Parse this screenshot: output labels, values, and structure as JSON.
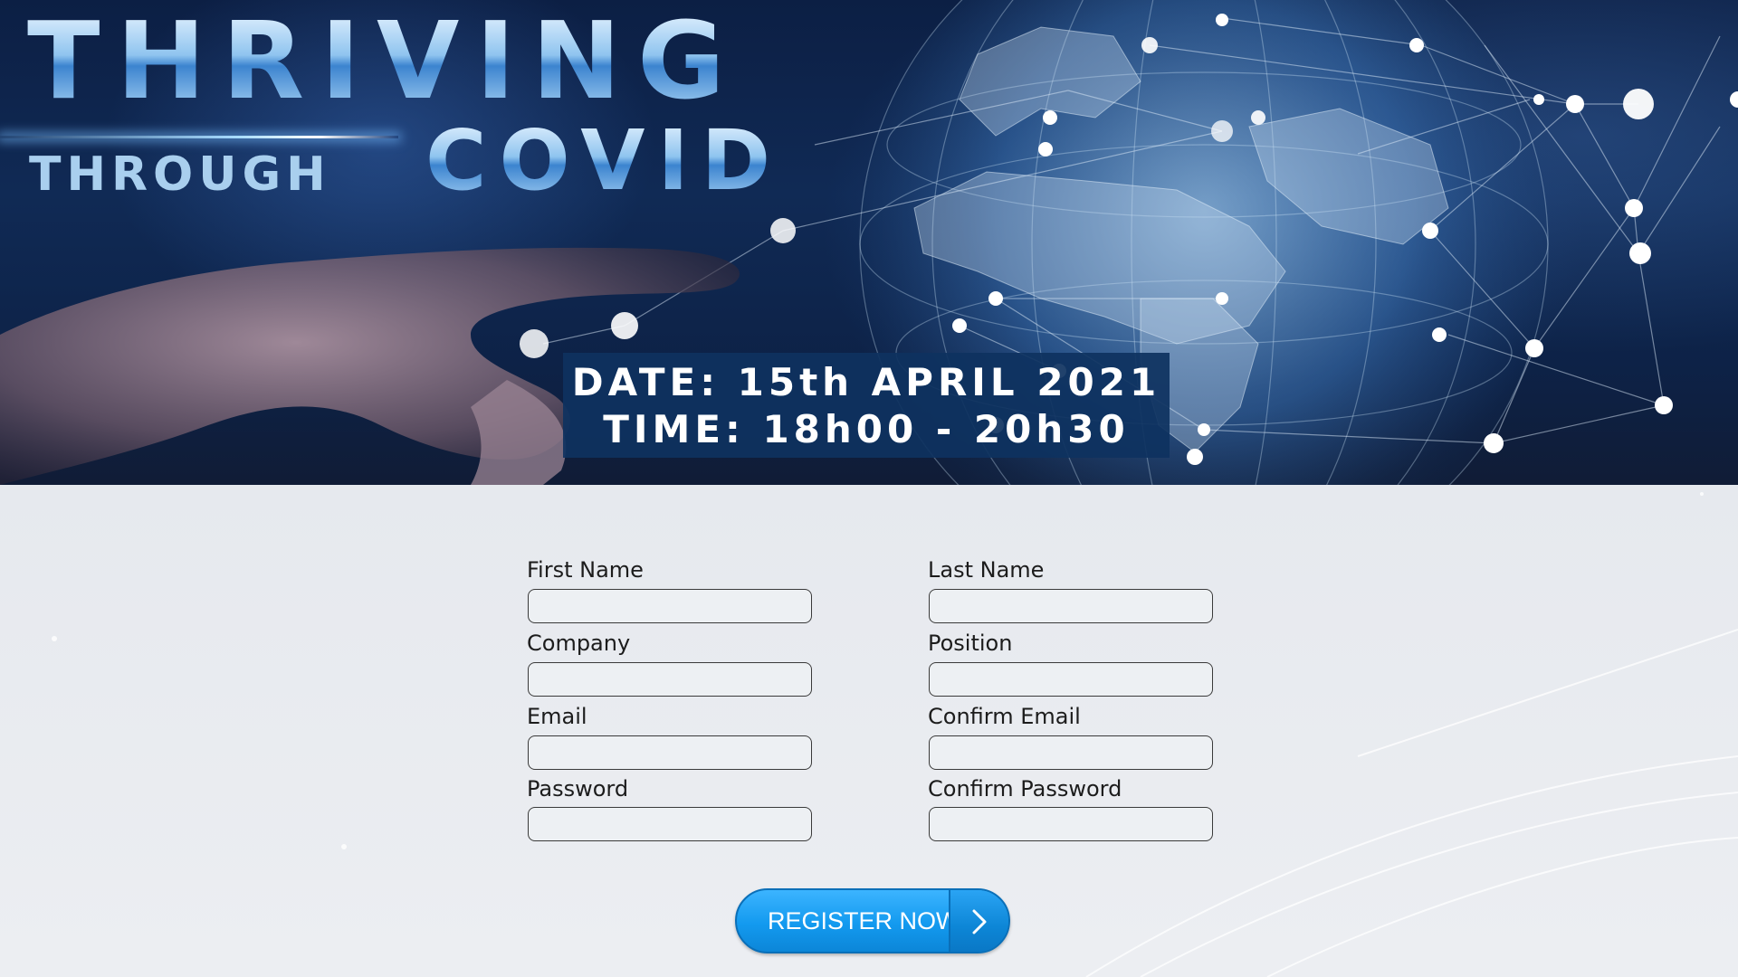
{
  "hero": {
    "title_line1": "THRIVING",
    "title_line2_left": "THROUGH",
    "title_line2_right": "COVID",
    "date_line": "DATE: 15th APRIL 2021",
    "time_line": "TIME: 18h00 - 20h30"
  },
  "form": {
    "first_name": {
      "label": "First Name",
      "value": ""
    },
    "last_name": {
      "label": "Last Name",
      "value": ""
    },
    "company": {
      "label": "Company",
      "value": ""
    },
    "position": {
      "label": "Position",
      "value": ""
    },
    "email": {
      "label": "Email",
      "value": ""
    },
    "confirm_email": {
      "label": "Confirm Email",
      "value": ""
    },
    "password": {
      "label": "Password",
      "value": ""
    },
    "confirm_password": {
      "label": "Confirm Password",
      "value": ""
    }
  },
  "register_button": {
    "label": "REGISTER NOW",
    "icon": "chevron-right-icon"
  },
  "colors": {
    "hero_background": "#0f2a55",
    "date_box": "#0e3260",
    "button_blue": "#139aef",
    "form_background": "#e9ecf0"
  }
}
